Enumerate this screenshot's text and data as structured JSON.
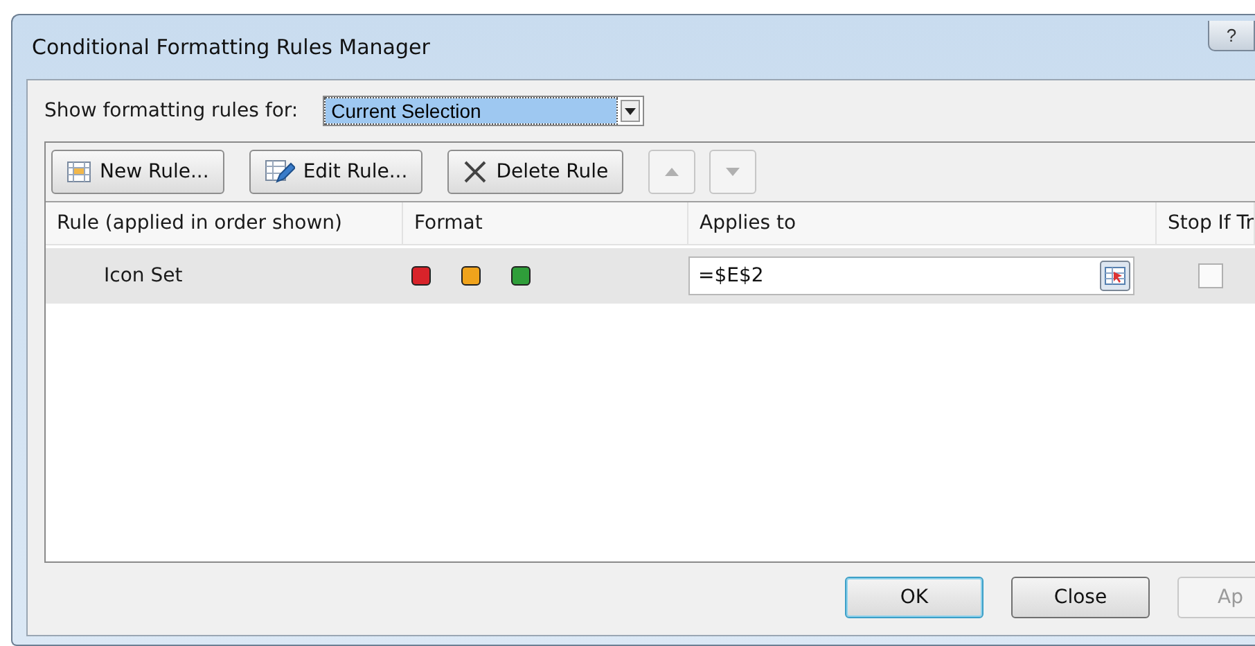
{
  "window": {
    "title": "Conditional Formatting Rules Manager",
    "help": "?"
  },
  "show_for": {
    "label": "Show formatting rules for:",
    "value": "Current Selection"
  },
  "toolbar": [
    {
      "label": "New Rule...",
      "kind": "new",
      "disabled": false
    },
    {
      "label": "Edit Rule...",
      "kind": "edit",
      "disabled": false
    },
    {
      "label": "Delete Rule",
      "kind": "delete",
      "disabled": false
    },
    {
      "kind": "up",
      "disabled": true
    },
    {
      "kind": "down",
      "disabled": true
    }
  ],
  "table": {
    "columns": [
      "Rule (applied in order shown)",
      "Format",
      "Applies to",
      "Stop If Tr"
    ],
    "rows": [
      {
        "rule": "Icon Set",
        "format_icons": [
          {
            "color": "#d8232a"
          },
          {
            "color": "#f0a31c"
          },
          {
            "color": "#2f9e3a"
          }
        ],
        "applies_to": "=$E$2",
        "stop_if_true": false,
        "selected": true
      }
    ]
  },
  "buttons": [
    {
      "label": "OK",
      "default": true,
      "disabled": false
    },
    {
      "label": "Close",
      "default": false,
      "disabled": false
    },
    {
      "label": "Ap",
      "default": false,
      "disabled": true
    }
  ]
}
